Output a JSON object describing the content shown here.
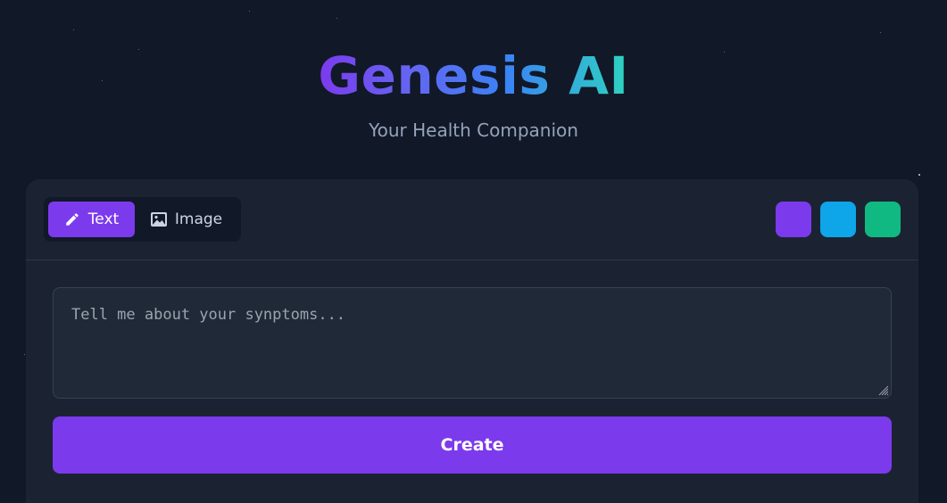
{
  "header": {
    "title": "Genesis AI",
    "subtitle": "Your Health Companion"
  },
  "modes": [
    {
      "label": "Text",
      "icon": "pencil-icon",
      "active": true
    },
    {
      "label": "Image",
      "icon": "image-icon",
      "active": false
    }
  ],
  "theme_swatches": [
    {
      "name": "purple",
      "color": "#7c3aed"
    },
    {
      "name": "blue",
      "color": "#0ea5e9"
    },
    {
      "name": "green",
      "color": "#10b981"
    }
  ],
  "symptom_input": {
    "value": "",
    "placeholder": "Tell me about your synptoms..."
  },
  "create_label": "Create",
  "colors": {
    "background": "#111827",
    "card": "#1b2332",
    "accent": "#7c3aed"
  }
}
